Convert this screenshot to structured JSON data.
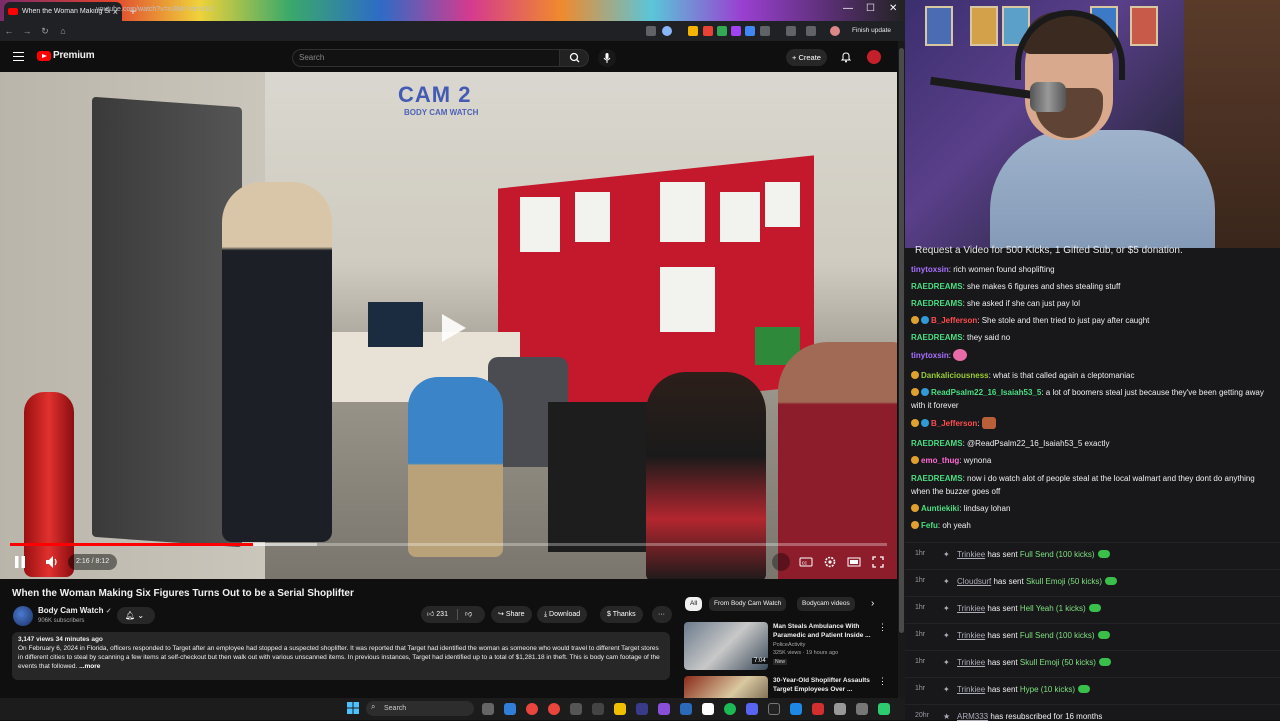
{
  "browser": {
    "tab_title": "When the Woman Making Six Figures...",
    "url": "youtube.com/watch?v=nJlMnYdmVL0",
    "finish_update": "Finish update"
  },
  "yt": {
    "brand": "Premium",
    "search_placeholder": "Search",
    "create_label": "Create"
  },
  "player": {
    "watermark": "CAM 2",
    "watermark_sub": "BODY CAM WATCH",
    "time": "2:16 / 8:12",
    "progress": 0.277,
    "buffered": 0.35
  },
  "video": {
    "title": "When the Woman Making Six Figures Turns Out to be a Serial Shoplifter",
    "channel": "Body Cam Watch",
    "subscribers": "906K subscribers",
    "likes": "231",
    "share": "Share",
    "download": "Download",
    "thanks": "Thanks",
    "meta": "3,147 views  34 minutes ago",
    "description": "On February 6, 2024 in Florida, officers responded to Target after an employee had stopped a suspected shoplifter. It was reported that Target had identified the woman as someone who would travel to different Target stores in different cities to steal by scanning a few items at self-checkout but then walk out with various unscanned items. In previous instances, Target had identified up to a total of $1,281.18 in theft. This is body cam footage of the events that followed.",
    "more": "...more"
  },
  "chips": [
    "All",
    "From Body Cam Watch",
    "Bodycam videos"
  ],
  "recommendations": [
    {
      "title": "Man Steals Ambulance With Paramedic and Patient Inside ...",
      "channel": "PoliceActivity",
      "meta": "325K views · 19 hours ago",
      "badge": "New",
      "duration": "7:04"
    },
    {
      "title": "30-Year-Old Shoplifter Assaults Target Employees Over ...",
      "channel": "",
      "meta": "",
      "badge": "",
      "duration": ""
    }
  ],
  "stream": {
    "banner": "Request a Video for 500 Kicks, 1 Gifted Sub, or $5 donation."
  },
  "chat": [
    {
      "user": "tinytoxsin",
      "color": "#a970ff",
      "text": "rich women found shoplifting"
    },
    {
      "user": "RAEDREAMS",
      "color": "#4ade80",
      "text": "she makes 6 figures and shes stealing stuff"
    },
    {
      "user": "RAEDREAMS",
      "color": "#4ade80",
      "text": "she asked if she can just pay lol"
    },
    {
      "user": "B_Jefferson",
      "color": "#ff4d4d",
      "text": "She stole and then tried to just pay after caught"
    },
    {
      "user": "RAEDREAMS",
      "color": "#4ade80",
      "text": "they said no"
    },
    {
      "user": "tinytoxsin",
      "color": "#a970ff",
      "text": ""
    },
    {
      "user": "Dankaliciousness",
      "color": "#9acd32",
      "text": "what is that called again a cleptomaniac"
    },
    {
      "user": "ReadPsalm22_16_Isaiah53_5",
      "color": "#4ade80",
      "text": "a lot of boomers steal just because they've been getting away with it forever"
    },
    {
      "user": "B_Jefferson",
      "color": "#ff4d4d",
      "text": ""
    },
    {
      "user": "RAEDREAMS",
      "color": "#4ade80",
      "text": "@ReadPsalm22_16_Isaiah53_5 exactly"
    },
    {
      "user": "emo_thug",
      "color": "#ff69d4",
      "text": "wynona"
    },
    {
      "user": "RAEDREAMS",
      "color": "#4ade80",
      "text": "now i do watch alot of people steal at the local walmart and they dont do anything when the buzzer goes off"
    },
    {
      "user": "Auntiekiki",
      "color": "#4ade80",
      "text": "lindsay lohan"
    },
    {
      "user": "Fefu",
      "color": "#4ade80",
      "text": "oh yeah"
    }
  ],
  "events": [
    {
      "time": "1hr",
      "user": "Trinkiee",
      "action": "has sent",
      "item": "Full Send (100 kicks)"
    },
    {
      "time": "1hr",
      "user": "Cloudsurf",
      "action": "has sent",
      "item": "Skull Emoji (50 kicks)"
    },
    {
      "time": "1hr",
      "user": "Trinkiee",
      "action": "has sent",
      "item": "Hell Yeah (1 kicks)"
    },
    {
      "time": "1hr",
      "user": "Trinkiee",
      "action": "has sent",
      "item": "Full Send (100 kicks)"
    },
    {
      "time": "1hr",
      "user": "Trinkiee",
      "action": "has sent",
      "item": "Skull Emoji (50 kicks)"
    },
    {
      "time": "1hr",
      "user": "Trinkiee",
      "action": "has sent",
      "item": "Hype (10 kicks)"
    },
    {
      "time": "20hr",
      "user": "ARM333",
      "action": "has resubscribed for 16 months",
      "item": ""
    }
  ],
  "taskbar": {
    "search": "Search"
  }
}
